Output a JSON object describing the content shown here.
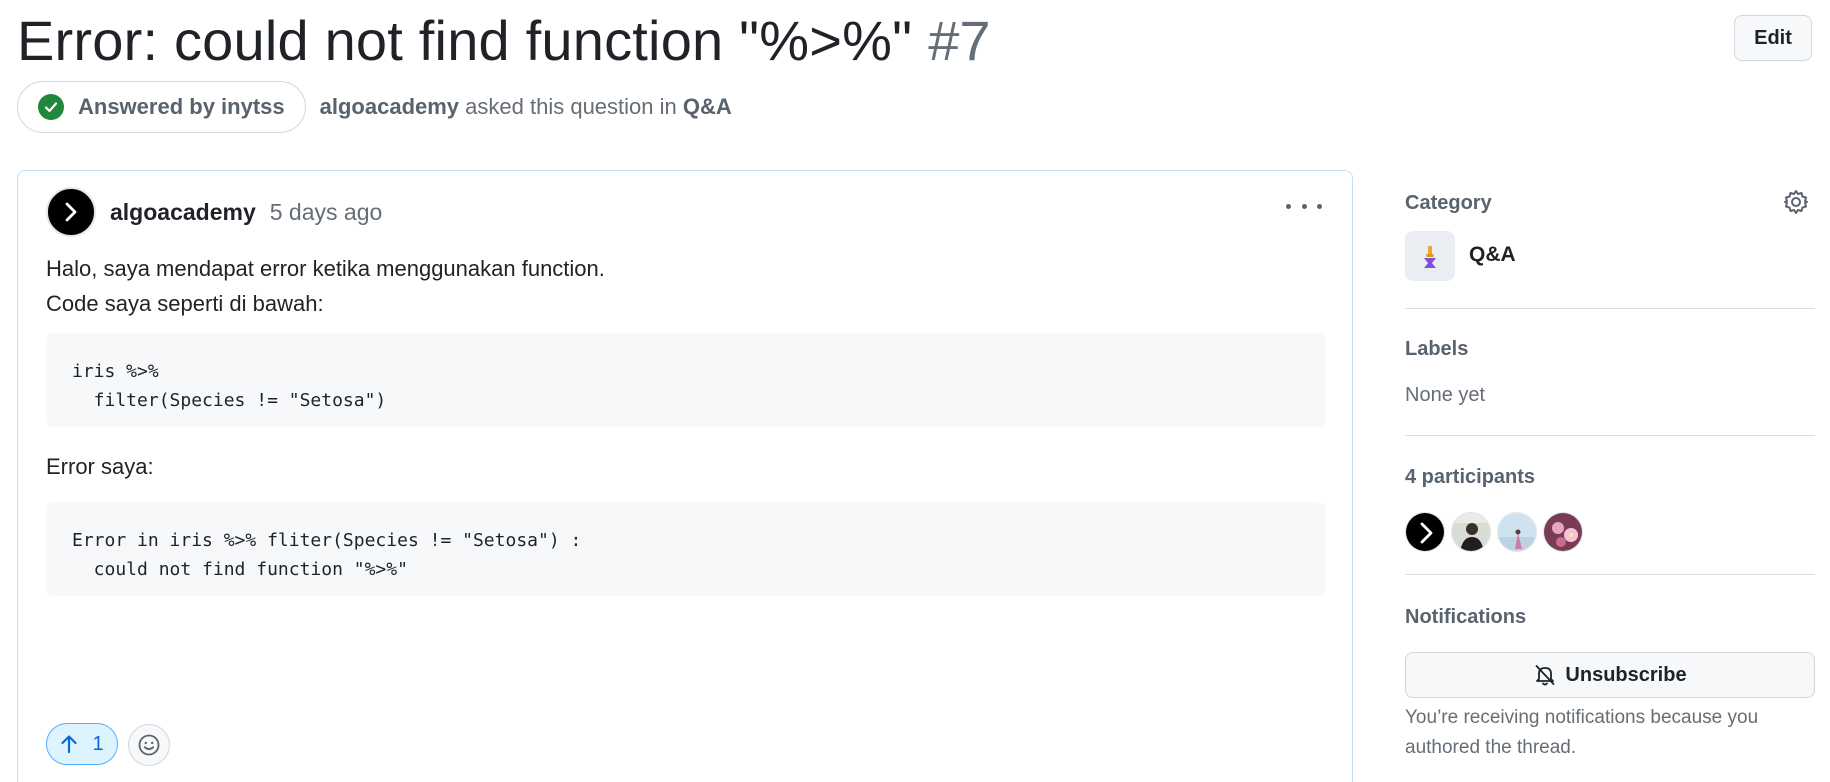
{
  "header": {
    "title": "Error: could not find function \"%>%\"",
    "number": "#7",
    "edit_label": "Edit"
  },
  "meta": {
    "answered_label": "Answered by inytss",
    "author": "algoacademy",
    "asked_text": "asked this question in",
    "category": "Q&A"
  },
  "post": {
    "author": "algoacademy",
    "time": "5 days ago",
    "paragraph1_line1": "Halo, saya mendapat error ketika menggunakan function.",
    "paragraph1_line2": "Code saya seperti di bawah:",
    "code1": "iris %>%\n  filter(Species != \"Setosa\")",
    "paragraph2": "Error saya:",
    "code2": "Error in iris %>% fliter(Species != \"Setosa\") :\n  could not find function \"%>%\"",
    "upvotes": "1"
  },
  "sidebar": {
    "category_heading": "Category",
    "category_name": "Q&A",
    "labels_heading": "Labels",
    "labels_value": "None yet",
    "participants_heading": "4 participants",
    "notifications_heading": "Notifications",
    "unsubscribe_label": "Unsubscribe",
    "notifications_note": "You’re receiving notifications because you authored the thread."
  },
  "colors": {
    "accent": "#0969da",
    "success": "#1f883d",
    "post_border": "#c8dff5"
  }
}
